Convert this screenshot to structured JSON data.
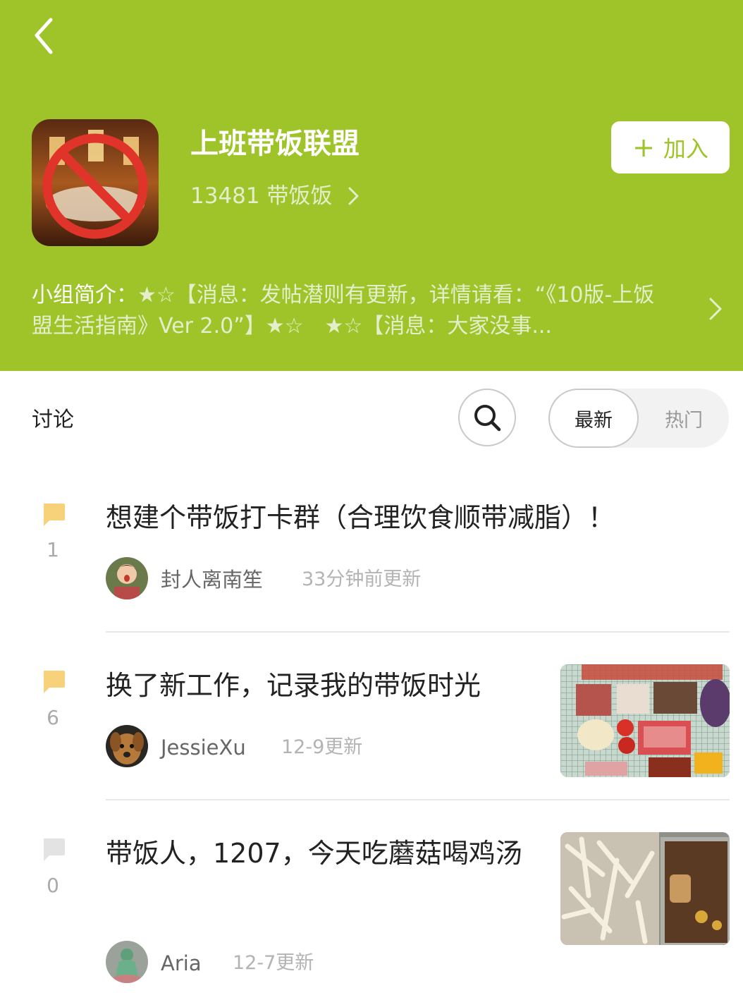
{
  "group": {
    "name": "上班带饭联盟",
    "member_count": "13481 带饭饭",
    "join_label": "加入",
    "join_icon": "+",
    "intro_label": "小组简介：",
    "intro_text": "★☆【消息：发帖潜则有更新，详情请看：“《10版-上饭盟生活指南》Ver 2.0”】★☆　★☆【消息：大家没事..."
  },
  "discussion": {
    "title": "讨论",
    "sort_latest": "最新",
    "sort_hot": "热门",
    "selected_sort": "最新"
  },
  "posts": [
    {
      "title": "想建个带饭打卡群（合理饮食顺带减脂）！",
      "comments": "1",
      "author": "封人离南笙",
      "time": "33分钟前更新",
      "comment_icon_color": "#f7d27a"
    },
    {
      "title": "换了新工作，记录我的带饭时光",
      "comments": "6",
      "author": "JessieXu",
      "time": "12-9更新",
      "comment_icon_color": "#f7d27a"
    },
    {
      "title": "带饭人，1207，今天吃蘑菇喝鸡汤",
      "comments": "0",
      "author": "Aria",
      "time": "12-7更新",
      "comment_icon_color": "#e3e3e3"
    }
  ],
  "colors": {
    "header_bg": "#9fc42a",
    "accent": "#9fc42a"
  }
}
